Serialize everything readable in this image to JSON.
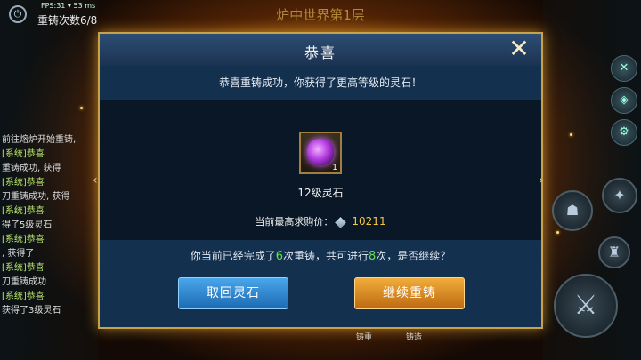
{
  "hud": {
    "fps": "FPS:31  ▾ 53 ms",
    "recast_count": "重铸次数6/8",
    "scene_title": "炉中世界第1层",
    "power_icon": "⏻"
  },
  "chat": [
    "前往熔炉开始重铸,",
    "[系统]恭喜",
    "重铸成功, 获得",
    "[系统]恭喜",
    "刀重铸成功, 获得",
    "[系统]恭喜",
    "得了5级灵石",
    "[系统]恭喜",
    ", 获得了",
    "[系统]恭喜",
    "刀重铸成功",
    "[系统]恭喜",
    "获得了3级灵石"
  ],
  "bottom_tabs": [
    "铸重",
    "铸造"
  ],
  "dialog": {
    "title": "恭喜",
    "close_glyph": "✕",
    "subtitle": "恭喜重铸成功，你获得了更高等级的灵石！",
    "item": {
      "icon": "purple-spirit-stone-icon",
      "count": "1",
      "name": "12级灵石"
    },
    "price": {
      "label": "当前最高求购价：",
      "icon": "silver-crystal-icon",
      "value": "10211"
    },
    "question": {
      "before": "你当前已经完成了",
      "done": "6",
      "middle": "次重铸，共可进行",
      "total": "8",
      "after": "次，是否继续？"
    },
    "buttons": {
      "retrieve": "取回灵石",
      "continue": "继续重铸"
    }
  },
  "colors": {
    "accent_gold": "#c8a24a",
    "price_gold": "#f3c640",
    "number_green": "#66e04a",
    "retrieve_blue": "#1c6bb3",
    "continue_orange": "#bd6a12"
  }
}
